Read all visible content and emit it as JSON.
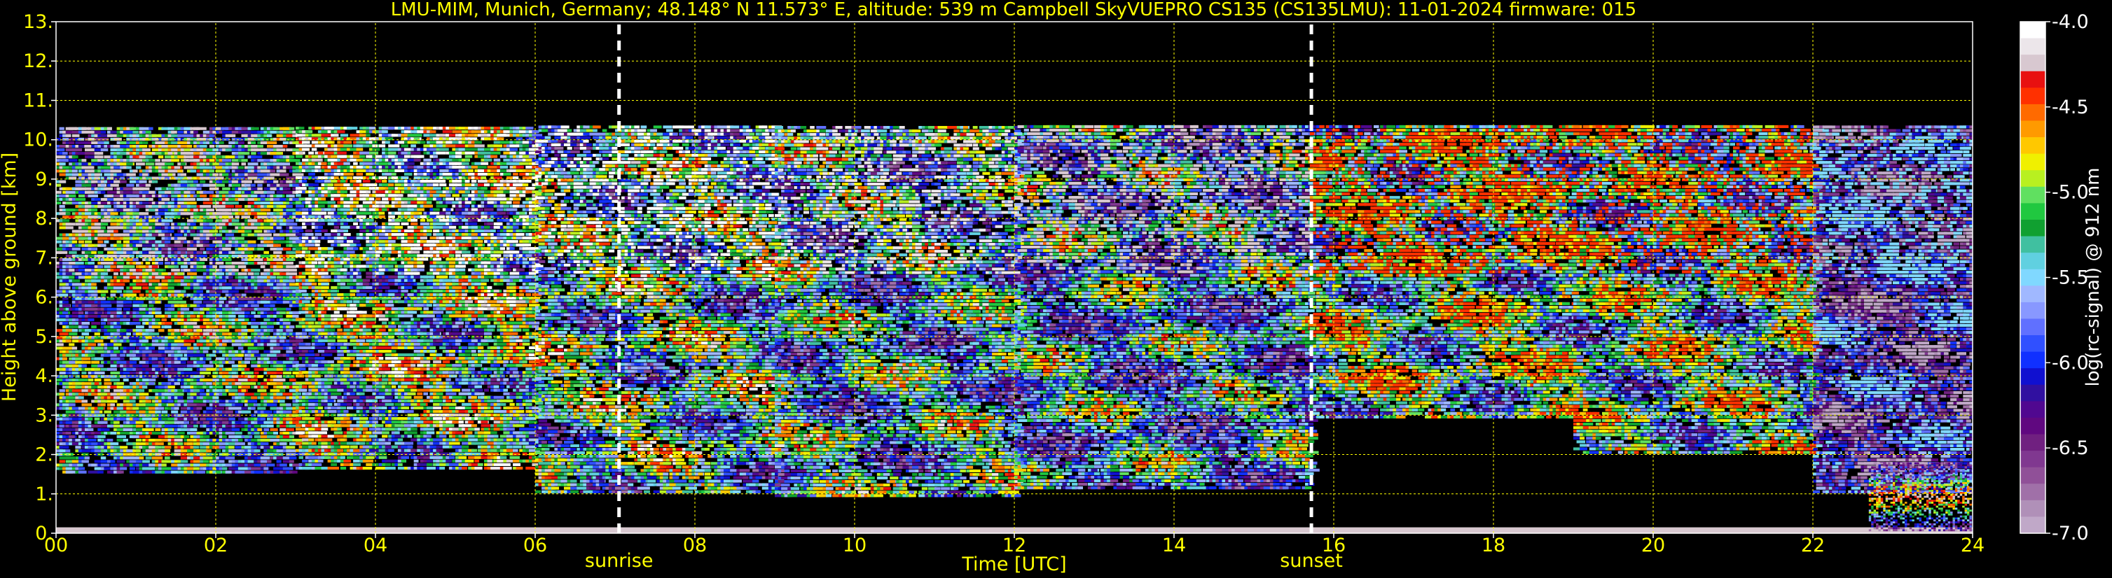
{
  "chart_data": {
    "type": "heatmap",
    "title": "LMU-MIM, Munich, Germany; 48.148° N 11.573° E, altitude: 539 m    Campbell SkyVUEPRO CS135 (CS135LMU): 11-01-2024    firmware: 015",
    "xlabel": "Time [UTC]",
    "ylabel": "Height above ground [km]",
    "xlim": [
      0,
      24
    ],
    "ylim": [
      0,
      13
    ],
    "x_ticks": [
      0,
      2,
      4,
      6,
      8,
      10,
      12,
      14,
      16,
      18,
      20,
      22,
      24
    ],
    "x_tick_labels": [
      "00",
      "02",
      "04",
      "06",
      "08",
      "10",
      "12",
      "14",
      "16",
      "18",
      "20",
      "22",
      "24"
    ],
    "y_ticks": [
      0,
      1,
      2,
      3,
      4,
      5,
      6,
      7,
      8,
      9,
      10,
      11,
      12,
      13
    ],
    "y_tick_labels": [
      "0.",
      "1.",
      "2.",
      "3.",
      "4.",
      "5.",
      "6.",
      "7.",
      "8.",
      "9.",
      "10.",
      "11.",
      "12.",
      "13."
    ],
    "grid": true,
    "annotations": [
      {
        "label": "sunrise",
        "x": 7.05
      },
      {
        "label": "sunset",
        "x": 15.72
      }
    ],
    "colorbar": {
      "label": "log(rc-signal) @ 912 nm",
      "range": [
        -7.0,
        -4.0
      ],
      "ticks": [
        -4.0,
        -4.5,
        -5.0,
        -5.5,
        -6.0,
        -6.5,
        -7.0
      ],
      "tick_labels": [
        "-4.0",
        "-4.5",
        "-5.0",
        "-5.5",
        "-6.0",
        "-6.5",
        "-7.0"
      ],
      "colors_top_to_bottom": [
        "#ffffff",
        "#ece6ea",
        "#d8c8d0",
        "#e81010",
        "#ff3000",
        "#ff6a00",
        "#ff9a00",
        "#ffc800",
        "#f0f000",
        "#b8f020",
        "#60e060",
        "#20c840",
        "#10a030",
        "#40c0a0",
        "#60d0e0",
        "#80d8ff",
        "#a0b8ff",
        "#8898ff",
        "#6070ff",
        "#3050ff",
        "#1030ff",
        "#1010d0",
        "#3010a0",
        "#500890",
        "#600880",
        "#702080",
        "#803890",
        "#905098",
        "#a070a8",
        "#b090b8",
        "#c0a8c8"
      ]
    },
    "backscatter_bands": [
      {
        "t0": 0.0,
        "t1": 3.0,
        "h0": 1.5,
        "h1": 10.25,
        "base_level": -5.4,
        "level_range": [
          -6.6,
          -4.2
        ]
      },
      {
        "t0": 3.0,
        "t1": 6.0,
        "h0": 1.6,
        "h1": 10.3,
        "base_level": -5.2,
        "level_range": [
          -6.5,
          -4.0
        ]
      },
      {
        "t0": 6.0,
        "t1": 9.0,
        "h0": 1.0,
        "h1": 10.3,
        "base_level": -5.3,
        "level_range": [
          -6.8,
          -4.0
        ]
      },
      {
        "t0": 9.0,
        "t1": 12.0,
        "h0": 0.9,
        "h1": 10.3,
        "base_level": -5.5,
        "level_range": [
          -6.8,
          -4.1
        ]
      },
      {
        "t0": 12.0,
        "t1": 15.7,
        "h0": 1.1,
        "h1": 10.3,
        "base_level": -5.6,
        "level_range": [
          -6.9,
          -4.2
        ]
      },
      {
        "t0": 15.7,
        "t1": 19.0,
        "h0": 2.9,
        "h1": 10.3,
        "base_level": -5.2,
        "level_range": [
          -6.5,
          -4.4
        ]
      },
      {
        "t0": 19.0,
        "t1": 22.0,
        "h0": 2.0,
        "h1": 10.3,
        "base_level": -5.3,
        "level_range": [
          -6.5,
          -4.4
        ]
      },
      {
        "t0": 22.0,
        "t1": 24.0,
        "h0": 1.0,
        "h1": 10.3,
        "base_level": -6.2,
        "level_range": [
          -7.0,
          -5.5
        ]
      }
    ],
    "surface_layer": {
      "h0": 0.0,
      "h1": 0.15,
      "level": -4.2
    },
    "low_cloud": {
      "t0": 22.7,
      "t1": 24.0,
      "h0": 0.05,
      "h1": 1.8,
      "level_range": [
        -7.0,
        -4.2
      ]
    }
  }
}
